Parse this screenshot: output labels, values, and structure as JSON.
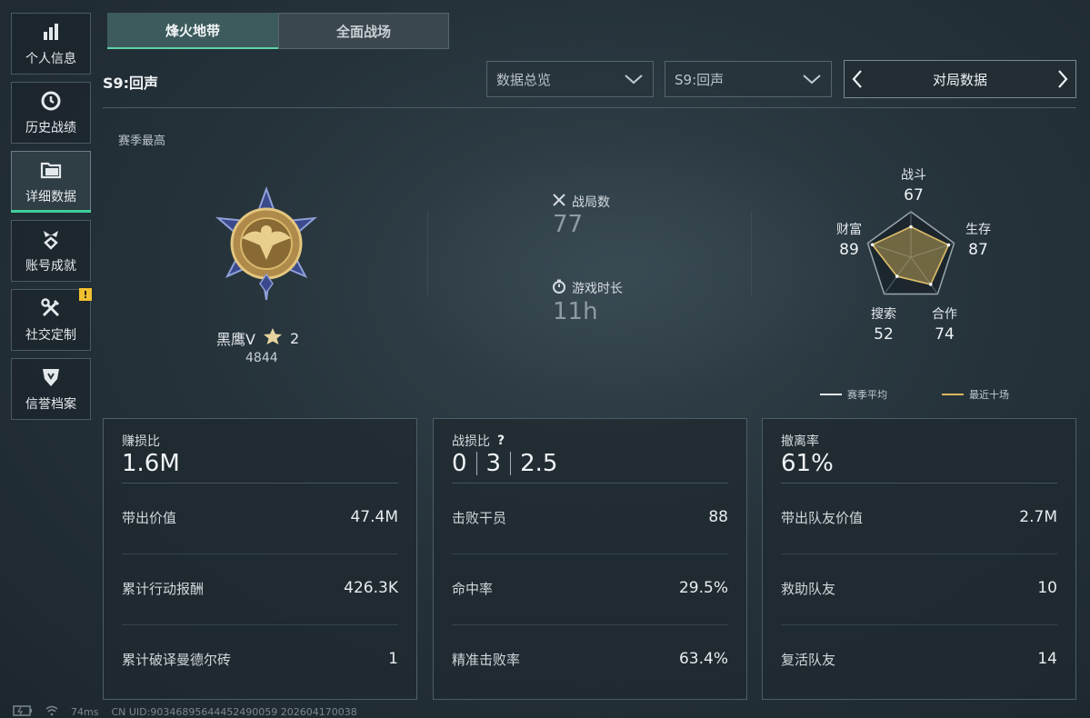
{
  "sidebar": {
    "items": [
      {
        "label": "个人信息",
        "icon": "bar-chart-icon"
      },
      {
        "label": "历史战绩",
        "icon": "history-clock-icon"
      },
      {
        "label": "详细数据",
        "icon": "folder-icon",
        "active": true
      },
      {
        "label": "账号成就",
        "icon": "medal-icon"
      },
      {
        "label": "社交定制",
        "icon": "tools-icon",
        "badge": "!"
      },
      {
        "label": "信誉档案",
        "icon": "shield-icon"
      }
    ]
  },
  "tabs": [
    {
      "label": "烽火地带",
      "active": true
    },
    {
      "label": "全面战场",
      "active": false
    }
  ],
  "header": {
    "season_title": "S9:回声",
    "select_overview": "数据总览",
    "select_season": "S9:回声",
    "pager_title": "对局数据"
  },
  "summary": {
    "season_best_label": "赛季最高",
    "rank_name": "黑鹰Ⅴ",
    "rank_stars": "2",
    "rank_score": "4844",
    "matches_label": "战局数",
    "matches_value": "77",
    "playtime_label": "游戏时长",
    "playtime_value": "11h"
  },
  "radar": {
    "axes": [
      {
        "label": "战斗",
        "value": "67"
      },
      {
        "label": "生存",
        "value": "87"
      },
      {
        "label": "合作",
        "value": "74"
      },
      {
        "label": "搜索",
        "value": "52"
      },
      {
        "label": "财富",
        "value": "89"
      }
    ],
    "legend_season": "赛季平均",
    "legend_recent": "最近十场",
    "color_season": "#e6ecef",
    "color_recent": "#d9b860"
  },
  "cards": {
    "profit": {
      "label": "赚损比",
      "value": "1.6M",
      "rows": [
        {
          "k": "带出价值",
          "v": "47.4M"
        },
        {
          "k": "累计行动报酬",
          "v": "426.3K"
        },
        {
          "k": "累计破译曼德尔砖",
          "v": "1"
        }
      ]
    },
    "kd": {
      "label": "战损比",
      "help": "?",
      "v1": "0",
      "v2": "3",
      "v3": "2.5",
      "rows": [
        {
          "k": "击败干员",
          "v": "88"
        },
        {
          "k": "命中率",
          "v": "29.5%"
        },
        {
          "k": "精准击败率",
          "v": "63.4%"
        }
      ]
    },
    "extract": {
      "label": "撤离率",
      "value": "61%",
      "rows": [
        {
          "k": "带出队友价值",
          "v": "2.7M"
        },
        {
          "k": "救助队友",
          "v": "10"
        },
        {
          "k": "复活队友",
          "v": "14"
        }
      ]
    }
  },
  "footer": {
    "ping": "74ms",
    "uid": "CN UID:903468956444524900​59 202604170038"
  }
}
